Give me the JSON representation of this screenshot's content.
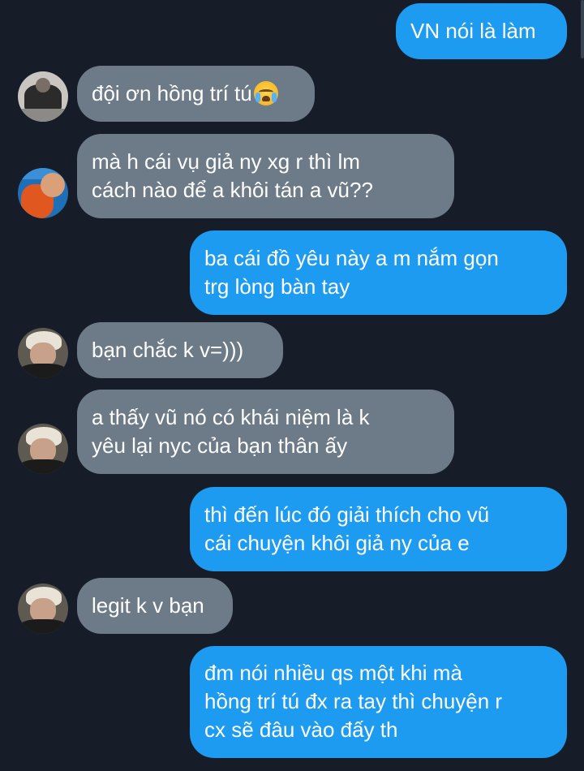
{
  "messages": [
    {
      "dir": "out",
      "lines": [
        "VN nói là làm"
      ]
    },
    {
      "dir": "in",
      "avatar": "group-photo-avatar",
      "lines": [
        "đội ơn hồng trí tú"
      ],
      "emoji": "loudly-crying-face-emoji"
    },
    {
      "dir": "in",
      "avatar": "orange-jersey-avatar",
      "lines": [
        "mà h cái vụ giả ny xg r thì lm",
        "cách nào để a khôi tán a vũ??"
      ]
    },
    {
      "dir": "out",
      "lines": [
        "ba cái đồ yêu này a m nắm gọn",
        "trg lòng bàn tay"
      ]
    },
    {
      "dir": "in",
      "avatar": "blonde-hair-avatar",
      "lines": [
        "bạn chắc k v=)))"
      ]
    },
    {
      "dir": "in",
      "avatar": "blonde-hair-avatar",
      "lines": [
        "a thấy vũ nó có khái niệm là k",
        "yêu lại nyc của bạn thân ấy"
      ]
    },
    {
      "dir": "out",
      "lines": [
        "thì đến lúc đó giải thích cho vũ",
        "cái chuyện khôi giả ny của e"
      ]
    },
    {
      "dir": "in",
      "avatar": "blonde-hair-avatar",
      "lines": [
        "legit k v bạn"
      ]
    },
    {
      "dir": "out",
      "lines": [
        "đm nói nhiều qs một khi mà",
        "hồng trí tú đx ra tay thì chuyện r",
        "cx sẽ đâu vào đấy th"
      ]
    }
  ],
  "colors": {
    "background": "#161d28",
    "outgoing_bubble": "#1d9bf0",
    "incoming_bubble": "#6d7a87",
    "text": "#ffffff"
  }
}
